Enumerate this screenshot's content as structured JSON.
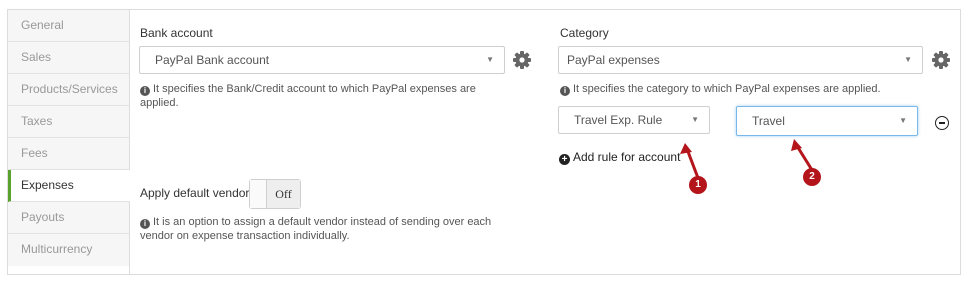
{
  "sidebar": {
    "items": [
      {
        "label": "General"
      },
      {
        "label": "Sales"
      },
      {
        "label": "Products/Services"
      },
      {
        "label": "Taxes"
      },
      {
        "label": "Fees"
      },
      {
        "label": "Expenses"
      },
      {
        "label": "Payouts"
      },
      {
        "label": "Multicurrency"
      }
    ],
    "active": "Expenses"
  },
  "bank_account": {
    "label": "Bank account",
    "selected": "PayPal Bank account",
    "help": "It specifies the Bank/Credit account to which PayPal expenses are applied."
  },
  "category": {
    "label": "Category",
    "selected": "PayPal expenses",
    "help": "It specifies the category to which PayPal expenses are applied.",
    "rule": {
      "rule_select": "Travel Exp. Rule",
      "value_select": "Travel"
    },
    "add_rule_label": "Add rule for account"
  },
  "default_vendor": {
    "label": "Apply default vendor",
    "toggle_state": "Off",
    "help": "It is an option to assign a default vendor instead of sending over each vendor on expense transaction individually."
  },
  "annotations": {
    "badge_1": "1",
    "badge_2": "2",
    "color": "#b3151b"
  },
  "colors": {
    "active_accent": "#5aa02c",
    "focus_border": "#7ab8e8"
  },
  "icons": {
    "settings": "gear-icon",
    "info": "info-icon",
    "add": "plus-circle-icon",
    "remove": "minus-circle-icon",
    "dropdown": "caret-down-icon"
  }
}
